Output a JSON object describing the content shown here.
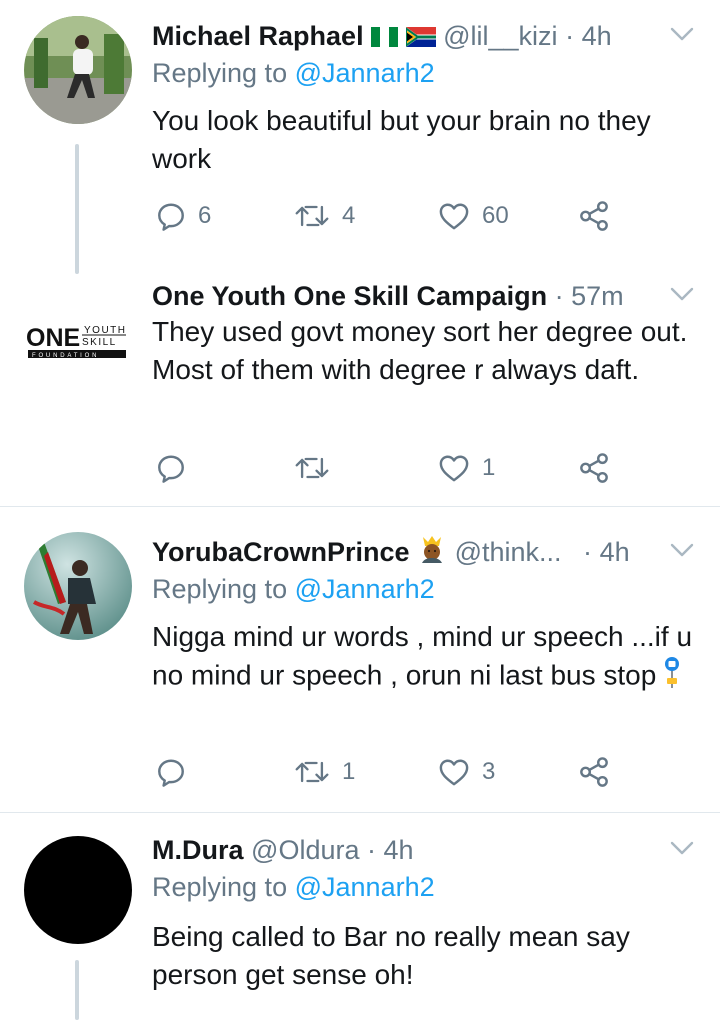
{
  "tweets": [
    {
      "name": "Michael Raphael",
      "handle": "@lil__kizi",
      "time": "4h",
      "replying_label": "Replying to",
      "replying_to": "@Jannarh2",
      "text": "You look beautiful but your brain no they work",
      "replies": "6",
      "retweets": "4",
      "likes": "60"
    },
    {
      "name": "One Youth One Skill Campaign",
      "time": "57m",
      "avatar_logo": {
        "big": "ONE",
        "top": "YOUTH",
        "mid": "SKILL",
        "bottom": "FOUNDATION"
      },
      "text": "They used govt money sort her degree out. Most of them with degree r always daft.",
      "replies": "",
      "retweets": "",
      "likes": "1"
    },
    {
      "name": "YorubaCrownPrince",
      "handle": "@think...",
      "time": "4h",
      "replying_label": "Replying to",
      "replying_to": "@Jannarh2",
      "text": "Nigga mind ur words , mind ur speech ...if u no mind ur speech , orun ni last bus stop",
      "replies": "",
      "retweets": "1",
      "likes": "3"
    },
    {
      "name": "M.Dura",
      "handle": "@Oldura",
      "time": "4h",
      "replying_label": "Replying to",
      "replying_to": "@Jannarh2",
      "text": "Being called to Bar no really mean say person get sense oh!"
    }
  ],
  "colors": {
    "link": "#1da1f2",
    "muted": "#657786",
    "text": "#14171a"
  },
  "icons": [
    "reply-icon",
    "retweet-icon",
    "like-icon",
    "share-icon",
    "chevron-down-icon",
    "nigeria-flag-icon",
    "south-africa-flag-icon",
    "prince-emoji",
    "bus-stop-emoji"
  ]
}
